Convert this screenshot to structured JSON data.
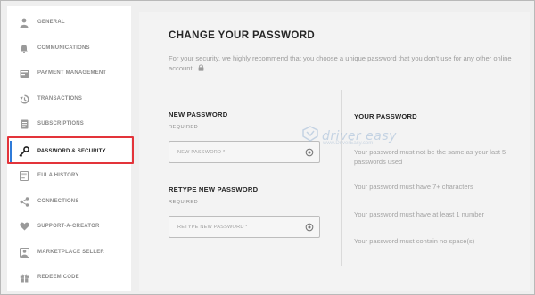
{
  "sidebar": {
    "items": [
      {
        "label": "GENERAL",
        "icon": "person-icon"
      },
      {
        "label": "COMMUNICATIONS",
        "icon": "bell-icon"
      },
      {
        "label": "PAYMENT MANAGEMENT",
        "icon": "card-icon"
      },
      {
        "label": "TRANSACTIONS",
        "icon": "history-icon"
      },
      {
        "label": "SUBSCRIPTIONS",
        "icon": "file-icon"
      },
      {
        "label": "PASSWORD & SECURITY",
        "icon": "key-icon",
        "active": true
      },
      {
        "label": "EULA HISTORY",
        "icon": "document-icon"
      },
      {
        "label": "CONNECTIONS",
        "icon": "share-icon"
      },
      {
        "label": "SUPPORT-A-CREATOR",
        "icon": "heart-icon"
      },
      {
        "label": "MARKETPLACE SELLER",
        "icon": "user-icon"
      },
      {
        "label": "REDEEM CODE",
        "icon": "gift-icon"
      }
    ]
  },
  "main": {
    "title": "CHANGE YOUR PASSWORD",
    "intro": "For your security, we highly recommend that you choose a unique password that you don't use for any other online account.",
    "new_password": {
      "label": "NEW PASSWORD",
      "required": "REQUIRED",
      "placeholder": "NEW PASSWORD *"
    },
    "retype_password": {
      "label": "RETYPE NEW PASSWORD",
      "required": "REQUIRED",
      "placeholder": "RETYPE NEW PASSWORD *"
    }
  },
  "rules": {
    "title": "YOUR PASSWORD",
    "items": [
      "Your password must not be the same as your last 5 passwords used",
      "Your password must have 7+ characters",
      "Your password must have at least 1 number",
      "Your password must contain no space(s)"
    ]
  },
  "watermark": {
    "brand": "driver easy",
    "url": "www.DriverEasy.com"
  },
  "colors": {
    "accent": "#2f7bd9",
    "highlight": "#e3343a"
  }
}
